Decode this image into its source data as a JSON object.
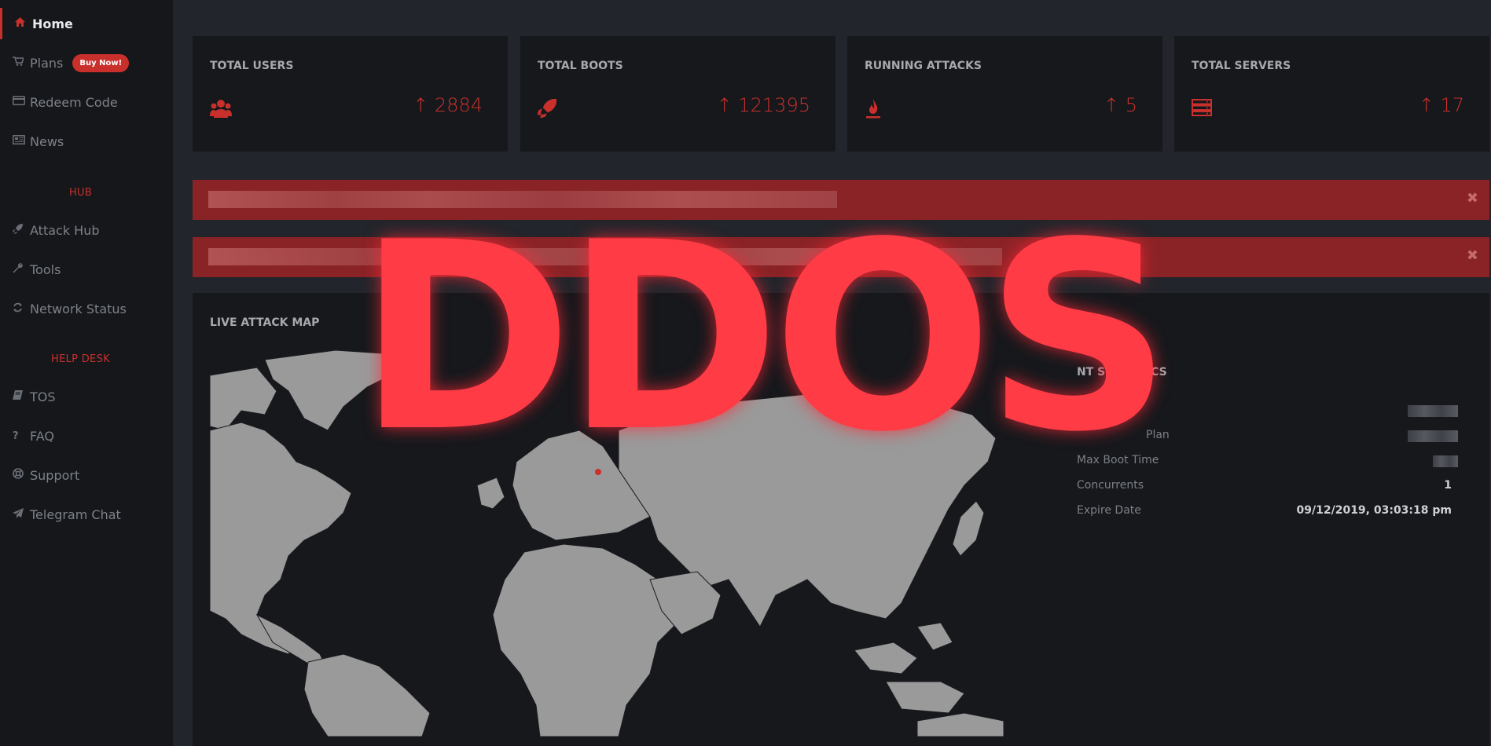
{
  "sidebar": {
    "items": [
      {
        "label": "Home",
        "icon": "home-icon",
        "active": true
      },
      {
        "label": "Plans",
        "icon": "cart-icon",
        "badge": "Buy Now!"
      },
      {
        "label": "Redeem Code",
        "icon": "credit-card-icon"
      },
      {
        "label": "News",
        "icon": "newspaper-icon"
      }
    ],
    "hub_label": "HUB",
    "hub_items": [
      {
        "label": "Attack Hub",
        "icon": "rocket-icon"
      },
      {
        "label": "Tools",
        "icon": "wrench-icon"
      },
      {
        "label": "Network Status",
        "icon": "refresh-icon"
      }
    ],
    "helpdesk_label": "HELP DESK",
    "helpdesk_items": [
      {
        "label": "TOS",
        "icon": "book-icon"
      },
      {
        "label": "FAQ",
        "icon": "question-icon"
      },
      {
        "label": "Support",
        "icon": "lifebuoy-icon"
      },
      {
        "label": "Telegram Chat",
        "icon": "paper-plane-icon"
      }
    ]
  },
  "cards": [
    {
      "title": "TOTAL USERS",
      "value": "2884",
      "icon": "users-icon"
    },
    {
      "title": "TOTAL BOOTS",
      "value": "121395",
      "icon": "rocket-icon"
    },
    {
      "title": "RUNNING ATTACKS",
      "value": "5",
      "icon": "fire-icon"
    },
    {
      "title": "TOTAL SERVERS",
      "value": "17",
      "icon": "server-icon"
    }
  ],
  "map": {
    "title": "LIVE ATTACK MAP",
    "zoom_in": "+",
    "zoom_out": "−"
  },
  "account_stats": {
    "title": "NT STATISTICS",
    "rows": [
      {
        "label": "U",
        "value": ""
      },
      {
        "label": "Plan",
        "value": ""
      },
      {
        "label": "Max Boot Time",
        "value": ""
      },
      {
        "label": "Concurrents",
        "value": "1"
      },
      {
        "label": "Expire Date",
        "value": "09/12/2019, 03:03:18 pm"
      }
    ]
  },
  "overlay_text": "DDOS",
  "colors": {
    "accent": "#c9302c",
    "overlay": "#ff3b46",
    "sidebar_bg": "#15171b",
    "page_bg": "#22252b",
    "card_bg": "#16181c",
    "alert_bg": "#8a2326"
  }
}
